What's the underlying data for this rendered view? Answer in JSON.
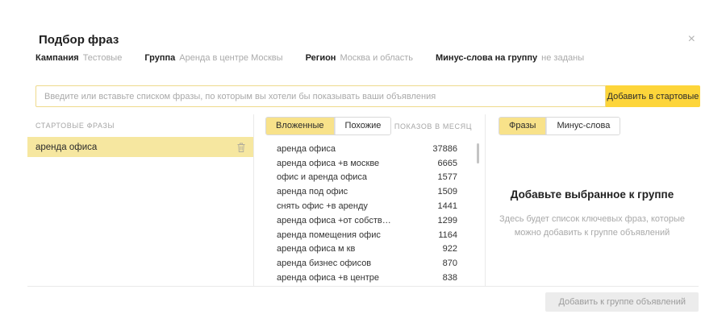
{
  "modal": {
    "title": "Подбор фраз",
    "close_glyph": "×"
  },
  "breadcrumbs": [
    {
      "label": "Кампания",
      "value": "Тестовые"
    },
    {
      "label": "Группа",
      "value": "Аренда в центре Москвы"
    },
    {
      "label": "Регион",
      "value": "Москва и область"
    },
    {
      "label": "Минус-слова на группу",
      "value": "не заданы"
    }
  ],
  "search": {
    "value": "",
    "placeholder": "Введите или вставьте списком фразы, по которым вы хотели бы показывать ваши объявления",
    "add_button": "Добавить в стартовые"
  },
  "starting_phrases": {
    "header": "Стартовые фразы",
    "items": [
      {
        "text": "аренда офиса",
        "selected": true
      }
    ]
  },
  "suggestions": {
    "tabs": [
      {
        "label": "Вложенные",
        "active": true
      },
      {
        "label": "Похожие",
        "active": false
      }
    ],
    "column_header": "Показов в месяц",
    "rows": [
      {
        "phrase": "аренда офиса",
        "shows": "37886"
      },
      {
        "phrase": "аренда офиса +в москве",
        "shows": "6665"
      },
      {
        "phrase": "офис и аренда офиса",
        "shows": "1577"
      },
      {
        "phrase": "аренда под офис",
        "shows": "1509"
      },
      {
        "phrase": "снять офис +в аренду",
        "shows": "1441"
      },
      {
        "phrase": "аренда офиса +от собств…",
        "shows": "1299"
      },
      {
        "phrase": "аренда помещения офис",
        "shows": "1164"
      },
      {
        "phrase": "аренда офиса м кв",
        "shows": "922"
      },
      {
        "phrase": "аренда бизнес офисов",
        "shows": "870"
      },
      {
        "phrase": "аренда офиса +в центре",
        "shows": "838"
      }
    ]
  },
  "selection": {
    "tabs": [
      {
        "label": "Фразы",
        "active": true
      },
      {
        "label": "Минус-слова",
        "active": false
      }
    ],
    "empty_title": "Добавьте выбранное к группе",
    "empty_text": "Здесь будет список ключевых фраз, которые можно добавить к группе объявлений"
  },
  "footer": {
    "add_button": "Добавить к группе объявлений"
  },
  "colors": {
    "accent_yellow": "#fdd53a",
    "selected_row_yellow": "#f6e7a0",
    "active_tab_yellow": "#f8e28a",
    "muted_text": "#a9a9a9"
  }
}
